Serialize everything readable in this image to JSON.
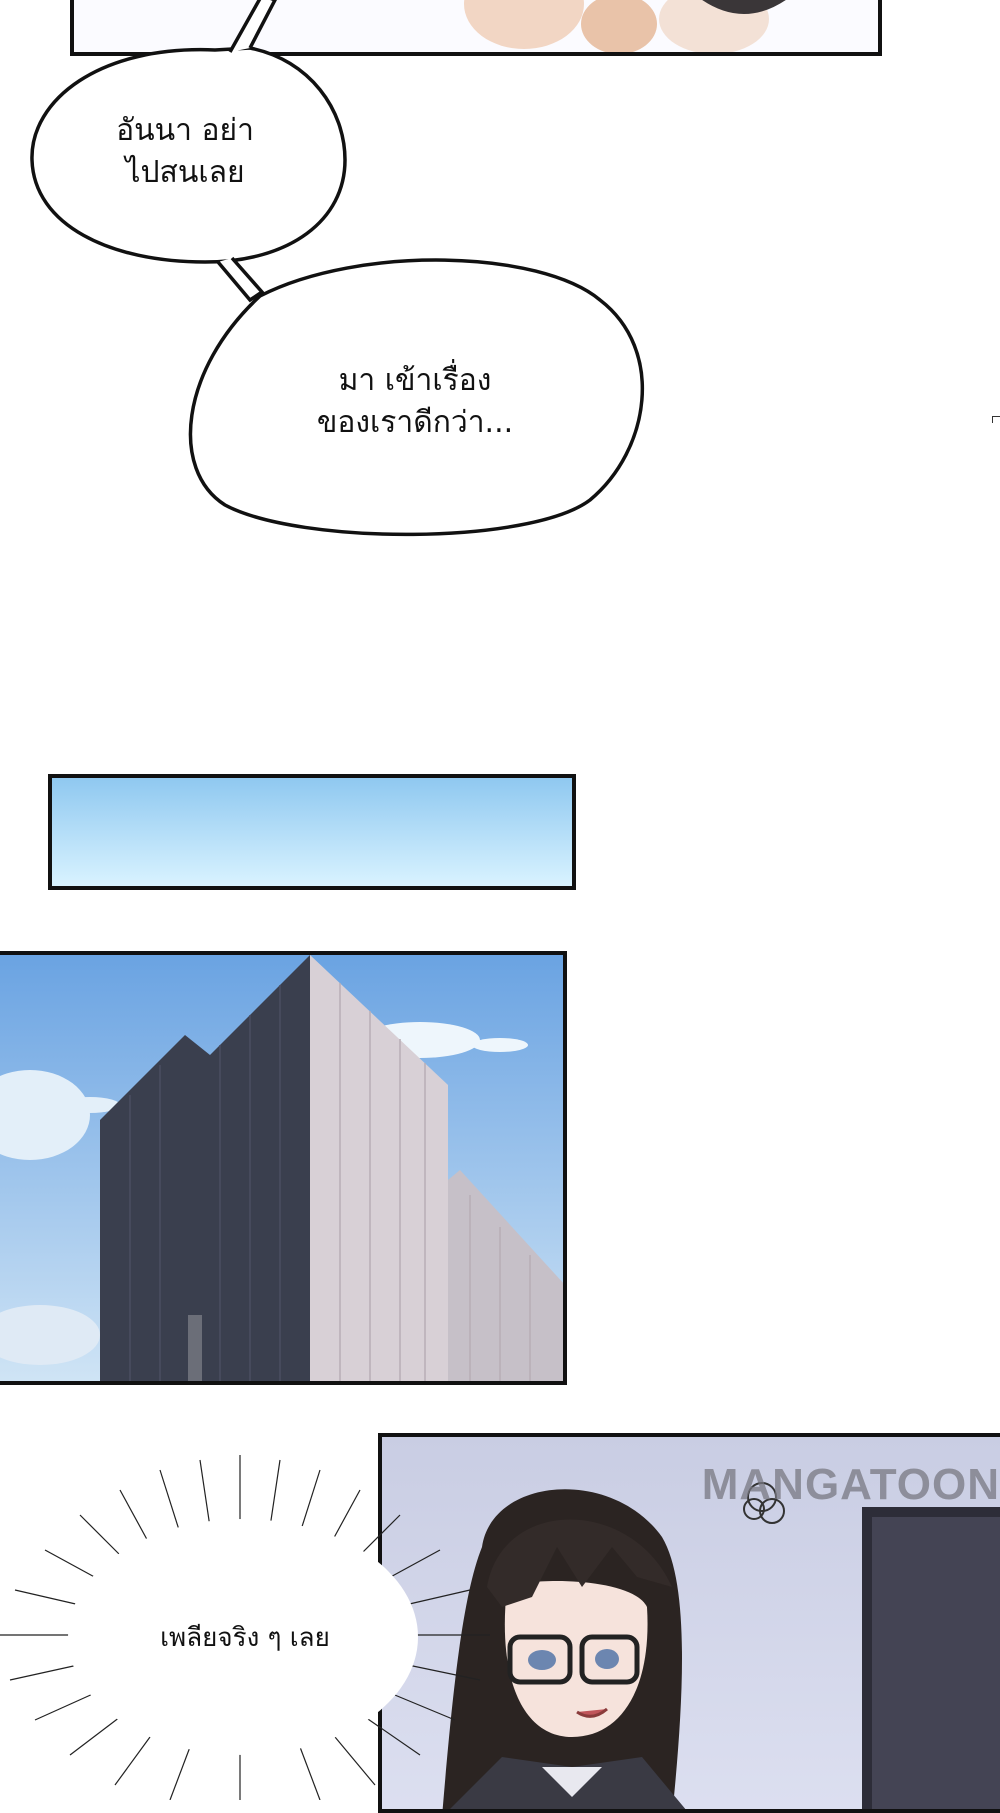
{
  "bubbles": [
    {
      "id": "bubble-1",
      "text": "อันนา อย่า\nไปสนเลย"
    },
    {
      "id": "bubble-2",
      "text": "มา เข้าเรื่อง\nของเราดีกว่า..."
    },
    {
      "id": "bubble-3",
      "text": "เพลียจริง ๆ เลย"
    }
  ],
  "watermark": "MANGATOON",
  "colors": {
    "border": "#111111",
    "sky_top": "#8fc8f0",
    "sky_bottom": "#d9f3ff",
    "building_dark": "#3a3f4e",
    "building_light": "#d8d0d6"
  }
}
